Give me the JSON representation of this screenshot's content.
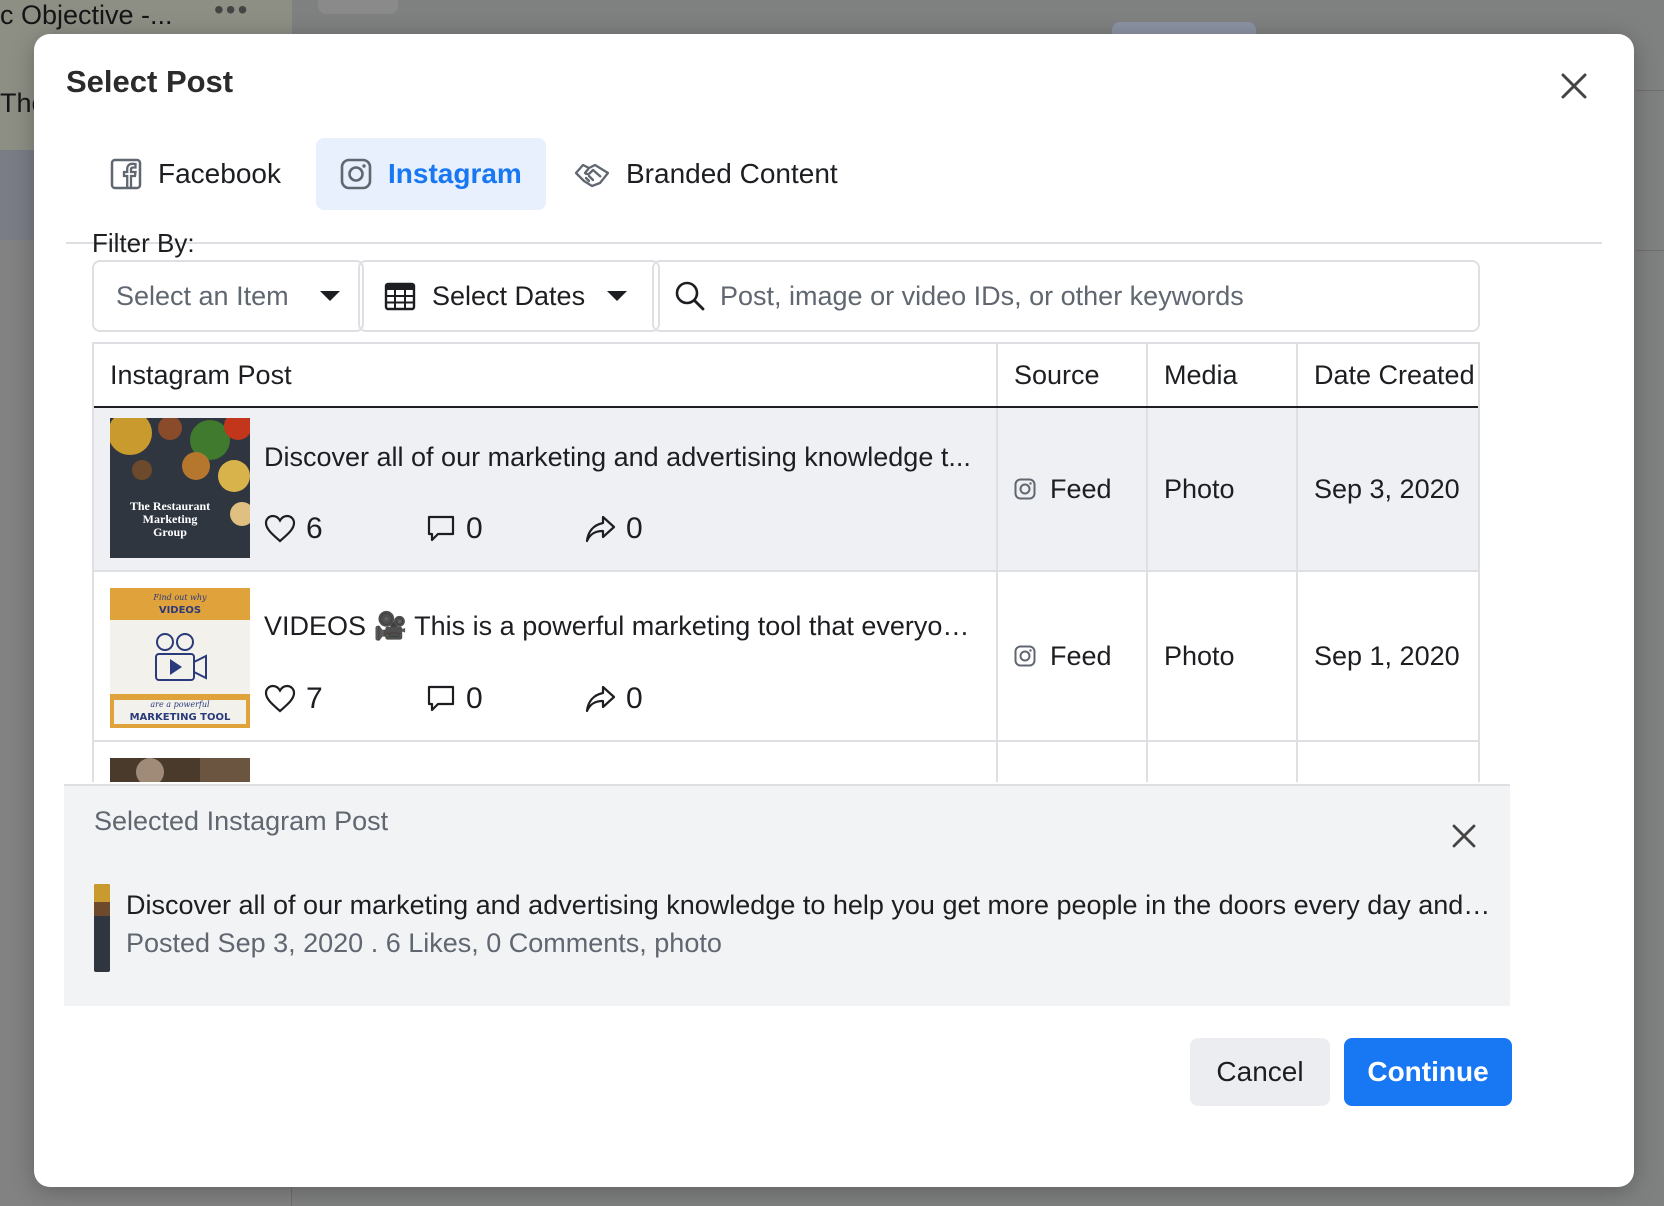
{
  "background": {
    "campaign_title": "c Objective -...",
    "more_label": "•••",
    "partial_text": "The"
  },
  "modal": {
    "title": "Select Post",
    "tabs": [
      {
        "label": "Facebook",
        "icon": "facebook-icon",
        "active": false
      },
      {
        "label": "Instagram",
        "icon": "instagram-icon",
        "active": true
      },
      {
        "label": "Branded Content",
        "icon": "handshake-icon",
        "active": false
      }
    ],
    "filter": {
      "label": "Filter By:",
      "item_select": "Select an Item",
      "date_select": "Select Dates",
      "search_placeholder": "Post, image or video IDs, or other keywords",
      "search_value": ""
    },
    "table": {
      "headers": [
        "Instagram Post",
        "Source",
        "Media",
        "Date Created"
      ],
      "rows": [
        {
          "caption": "Discover all of our marketing and advertising knowledge t...",
          "likes": "6",
          "comments": "0",
          "shares": "0",
          "source": "Feed",
          "media": "Photo",
          "date": "Sep 3, 2020",
          "thumb_text": "The Restaurant Marketing Group",
          "selected": true
        },
        {
          "caption": "VIDEOS 🎥 This is a powerful marketing tool that everyone ...",
          "likes": "7",
          "comments": "0",
          "shares": "0",
          "source": "Feed",
          "media": "Photo",
          "date": "Sep 1, 2020",
          "thumb_top_script": "Find out why",
          "thumb_top": "VIDEOS",
          "thumb_bottom_script": "are a powerful",
          "thumb_bottom": "MARKETING TOOL",
          "selected": false
        }
      ]
    },
    "selected_post": {
      "title": "Selected Instagram Post",
      "caption": "Discover all of our marketing and advertising knowledge to help you get more people in the doors every day and get ...",
      "meta": "Posted Sep 3, 2020 . 6 Likes, 0 Comments, photo"
    },
    "footer": {
      "cancel": "Cancel",
      "continue": "Continue"
    }
  },
  "colors": {
    "accent": "#1877f2",
    "active_tab_bg": "#e7f0fc",
    "selected_row_bg": "#eef0f3",
    "panel_bg": "#f2f3f5"
  }
}
